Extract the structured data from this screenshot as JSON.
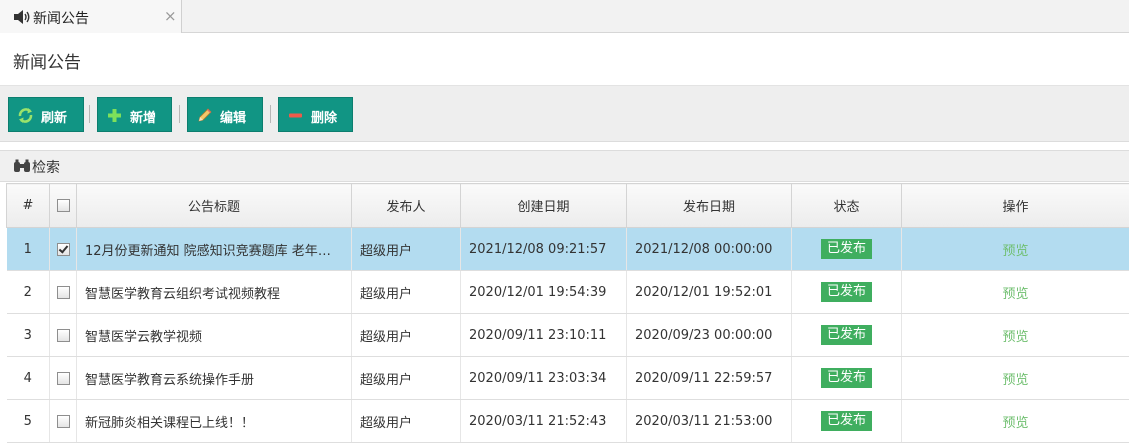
{
  "tab": {
    "label": "新闻公告",
    "icon": "speaker-icon",
    "close": "×"
  },
  "page": {
    "title": "新闻公告"
  },
  "toolbar": {
    "refresh": {
      "label": "刷新",
      "icon": "refresh-icon"
    },
    "add": {
      "label": "新增",
      "icon": "plus-icon"
    },
    "edit": {
      "label": "编辑",
      "icon": "pencil-icon"
    },
    "delete": {
      "label": "删除",
      "icon": "minus-icon"
    }
  },
  "search": {
    "label": "检索",
    "icon": "binoculars-icon"
  },
  "table": {
    "headers": {
      "num": "#",
      "title": "公告标题",
      "publisher": "发布人",
      "created": "创建日期",
      "published": "发布日期",
      "status": "状态",
      "ops": "操作"
    },
    "rows": [
      {
        "num": "1",
        "checked": true,
        "title": "12月份更新通知 院感知识竞赛题库 老年医…",
        "publisher": "超级用户",
        "created": "2021/12/08 09:21:57",
        "published": "2021/12/08 00:00:00",
        "status": "已发布",
        "op": "预览"
      },
      {
        "num": "2",
        "checked": false,
        "title": "智慧医学教育云组织考试视频教程",
        "publisher": "超级用户",
        "created": "2020/12/01 19:54:39",
        "published": "2020/12/01 19:52:01",
        "status": "已发布",
        "op": "预览"
      },
      {
        "num": "3",
        "checked": false,
        "title": "智慧医学云教学视频",
        "publisher": "超级用户",
        "created": "2020/09/11 23:10:11",
        "published": "2020/09/23 00:00:00",
        "status": "已发布",
        "op": "预览"
      },
      {
        "num": "4",
        "checked": false,
        "title": "智慧医学教育云系统操作手册",
        "publisher": "超级用户",
        "created": "2020/09/11 23:03:34",
        "published": "2020/09/11 22:59:57",
        "status": "已发布",
        "op": "预览"
      },
      {
        "num": "5",
        "checked": false,
        "title": "新冠肺炎相关课程已上线！！",
        "publisher": "超级用户",
        "created": "2020/03/11 21:52:43",
        "published": "2020/03/11 21:53:00",
        "status": "已发布",
        "op": "预览"
      }
    ]
  },
  "colors": {
    "button": "#119584",
    "selected_row": "#b3dcf0",
    "status_badge": "#3fae5f",
    "preview_link": "#6fbf6f"
  }
}
